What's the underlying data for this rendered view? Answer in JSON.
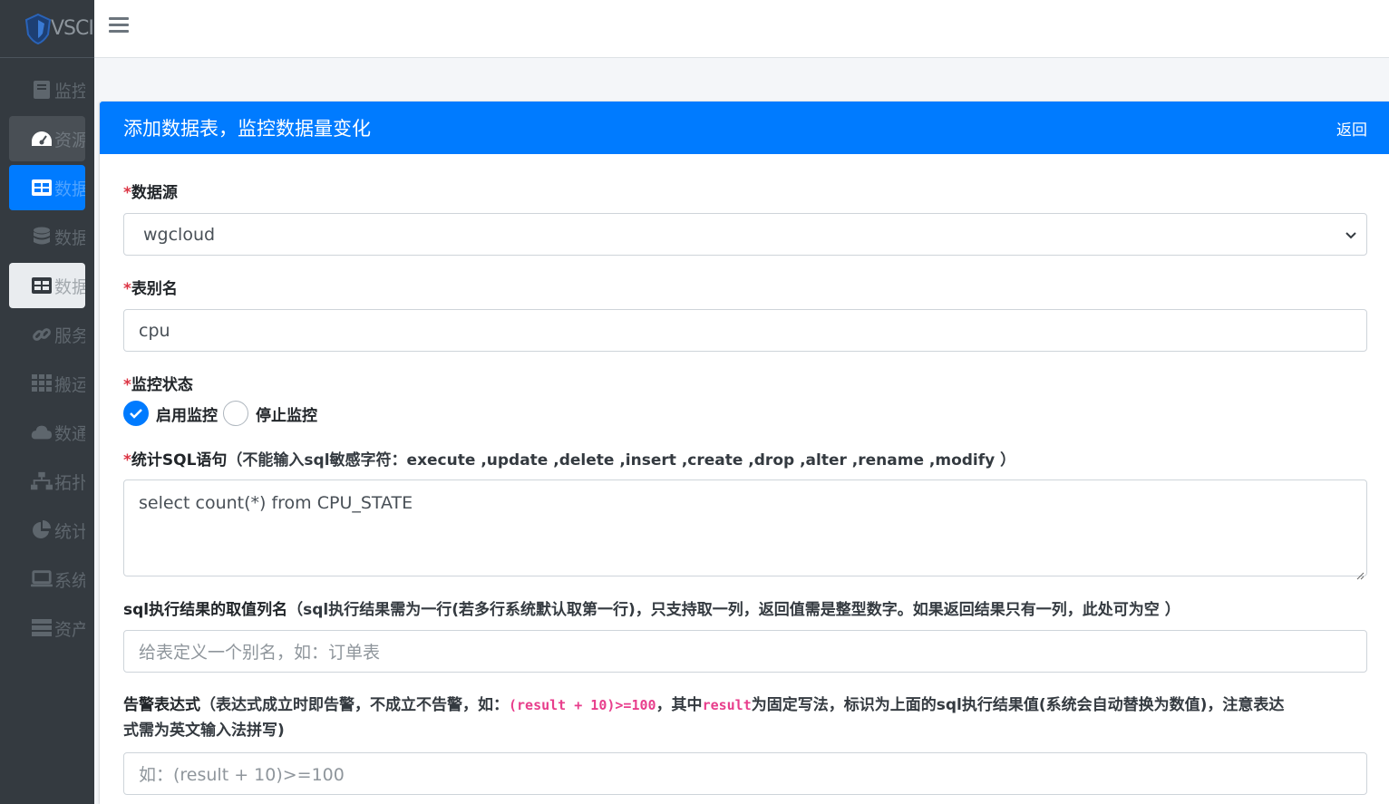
{
  "sidebar": {
    "brand_text": "VSCI",
    "items": [
      {
        "icon": "book-icon",
        "label": "监控"
      },
      {
        "icon": "dashboard-icon",
        "label": "资源"
      },
      {
        "icon": "table-icon",
        "label": "数据"
      },
      {
        "icon": "database-icon",
        "label": "数据"
      },
      {
        "icon": "table-icon",
        "label": "数据"
      },
      {
        "icon": "link-icon",
        "label": "服务"
      },
      {
        "icon": "grid-icon",
        "label": "搬运"
      },
      {
        "icon": "cloud-icon",
        "label": "数通"
      },
      {
        "icon": "sitemap-icon",
        "label": "拓扑"
      },
      {
        "icon": "pie-chart-icon",
        "label": "统计"
      },
      {
        "icon": "laptop-icon",
        "label": "系统"
      },
      {
        "icon": "server-icon",
        "label": "资产"
      }
    ]
  },
  "card": {
    "title": "添加数据表，监控数据量变化",
    "back_label": "返回"
  },
  "form": {
    "required_mark": "*",
    "datasource": {
      "label": "数据源",
      "value": "wgcloud"
    },
    "alias": {
      "label": "表别名",
      "value": "cpu"
    },
    "status": {
      "label": "监控状态",
      "options": [
        "启用监控",
        "停止监控"
      ],
      "selected": "启用监控"
    },
    "sql": {
      "label": "统计SQL语句",
      "hint": "（不能输入sql敏感字符：execute ,update ,delete ,insert ,create ,drop ,alter ,rename ,modify ）",
      "value": "select count(*) from CPU_STATE"
    },
    "result_column": {
      "label": "sql执行结果的取值列名",
      "hint": "（sql执行结果需为一行(若多行系统默认取第一行)，只支持取一列，返回值需是整型数字。如果返回结果只有一列，此处可为空 ）",
      "placeholder": "给表定义一个别名，如：订单表"
    },
    "alarm": {
      "label": "告警表达式",
      "hint_1": "（表达式成立时即告警，不成立不告警，如：",
      "code_1": "(result + 10)>=100",
      "hint_2": "，其中",
      "code_2": "result",
      "hint_3": "为固定写法，标识为上面的sql执行结果值(系统会自动替换为数值)，注意表达",
      "hint_4": "式需为英文输入法拼写)",
      "placeholder": "如：(result + 10)>=100"
    }
  },
  "colors": {
    "primary": "#007bff",
    "sidebar": "#343a40",
    "danger": "#dc3545",
    "code": "#e83e8c"
  }
}
